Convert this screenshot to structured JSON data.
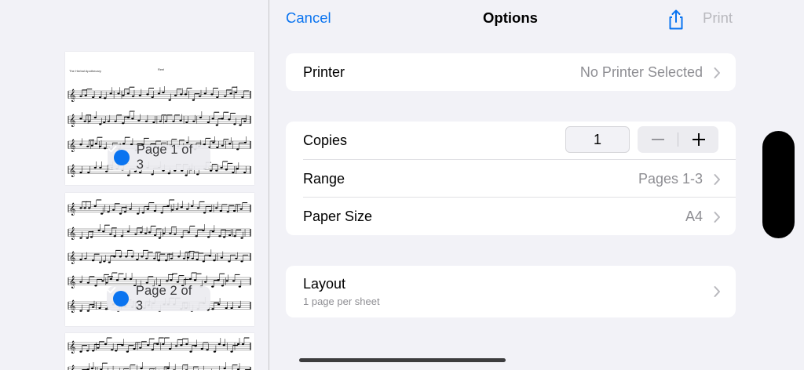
{
  "nav": {
    "cancel_label": "Cancel",
    "title": "Options",
    "share_icon": "share-icon",
    "print_label": "Print"
  },
  "preview": {
    "header_left": "The Herbal Apothecary",
    "header_center": "Reel",
    "pages": [
      {
        "badge": "Page 1 of 3",
        "selected": true
      },
      {
        "badge": "Page 2 of 3",
        "selected": true
      },
      {
        "badge": "",
        "selected": false
      }
    ]
  },
  "printer": {
    "label": "Printer",
    "value": "No Printer Selected"
  },
  "copies": {
    "label": "Copies",
    "value": "1",
    "minus_symbol": "−",
    "plus_symbol": "+"
  },
  "range": {
    "label": "Range",
    "value": "Pages 1-3"
  },
  "paper": {
    "label": "Paper Size",
    "value": "A4"
  },
  "layout": {
    "label": "Layout",
    "sublabel": "1 page per sheet"
  },
  "colors": {
    "accent": "#0a74f0",
    "disabled": "#b8b8bd",
    "secondary": "#8e8e93",
    "background": "#f2f2f7"
  }
}
